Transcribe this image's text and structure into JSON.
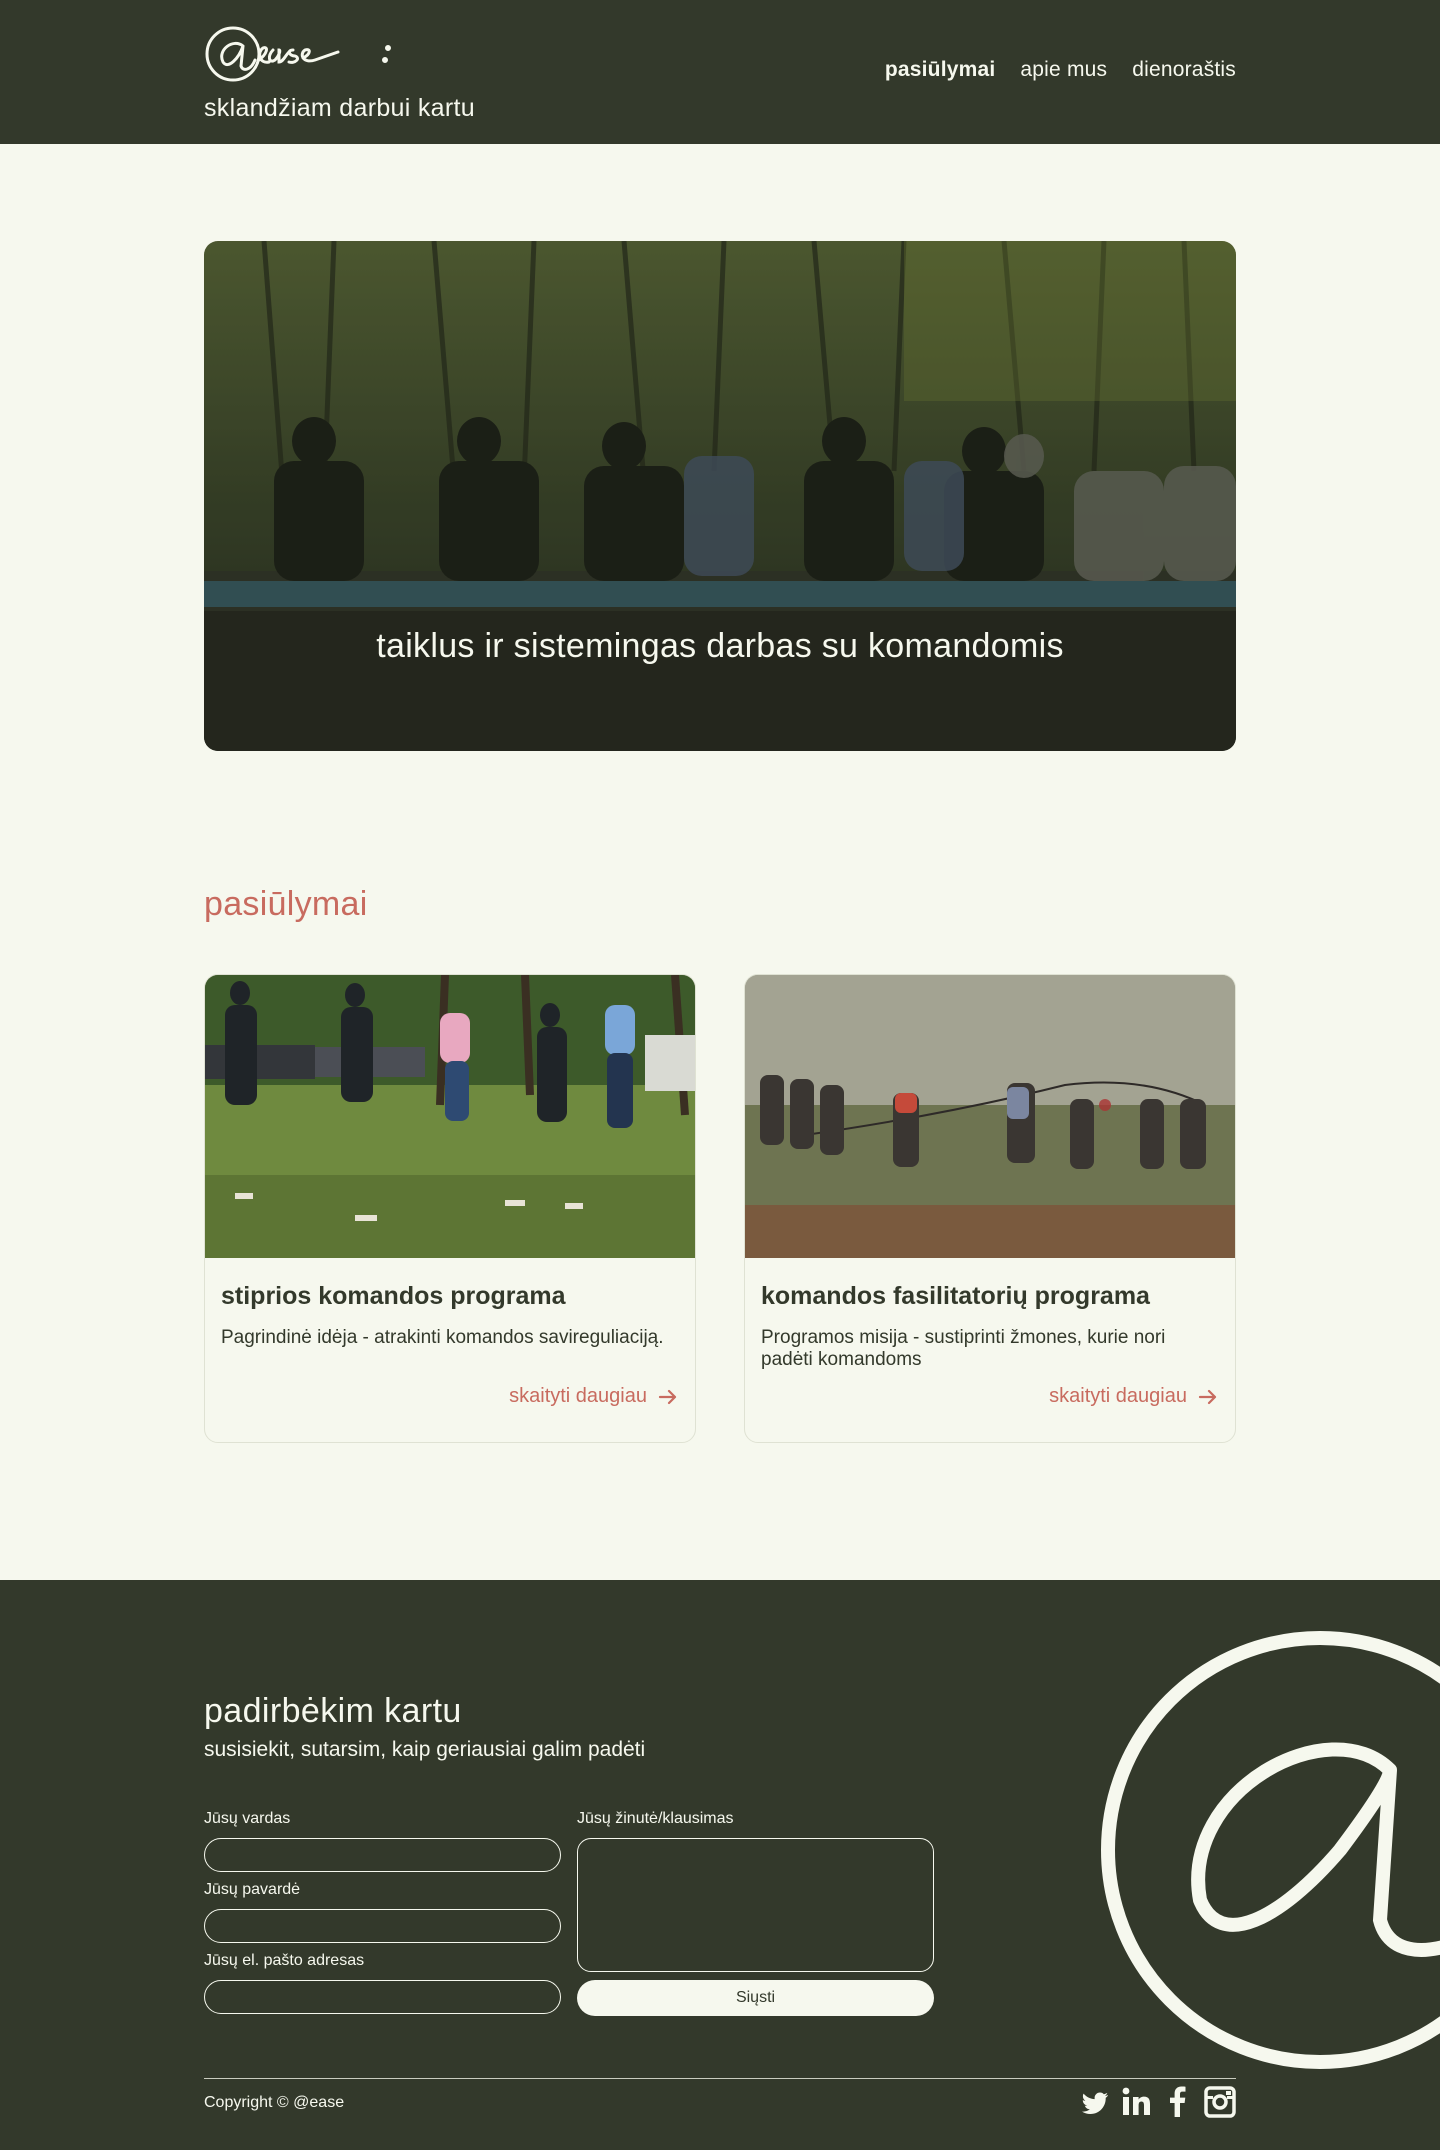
{
  "header": {
    "tagline": "sklandžiam darbui kartu",
    "nav": [
      {
        "label": "pasiūlymai",
        "active": true
      },
      {
        "label": "apie mus",
        "active": false
      },
      {
        "label": "dienoraštis",
        "active": false
      }
    ]
  },
  "hero": {
    "caption": "taiklus ir sistemingas darbas su komandomis"
  },
  "offers": {
    "title": "pasiūlymai",
    "cards": [
      {
        "title": "stiprios komandos programa",
        "description": "Pagrindinė idėja - atrakinti komandos savireguliaciją.",
        "more": "skaityti daugiau"
      },
      {
        "title": "komandos fasilitatorių programa",
        "description": "Programos misija - sustiprinti žmones, kurie nori padėti komandoms",
        "more": "skaityti daugiau"
      }
    ]
  },
  "footer": {
    "title": "padirbėkim kartu",
    "subtitle": "susisiekit, sutarsim, kaip geriausiai galim padėti",
    "form": {
      "first_name_label": "Jūsų vardas",
      "last_name_label": "Jūsų pavardė",
      "email_label": "Jūsų el. pašto adresas",
      "message_label": "Jūsų žinutė/klausimas",
      "submit": "Siųsti"
    },
    "copyright": "Copyright © @ease",
    "socials": [
      "twitter-icon",
      "linkedin-icon",
      "facebook-icon",
      "instagram-icon"
    ]
  },
  "colors": {
    "dark": "#33392b",
    "light": "#f6f8ee",
    "accent": "#c86b5f"
  }
}
